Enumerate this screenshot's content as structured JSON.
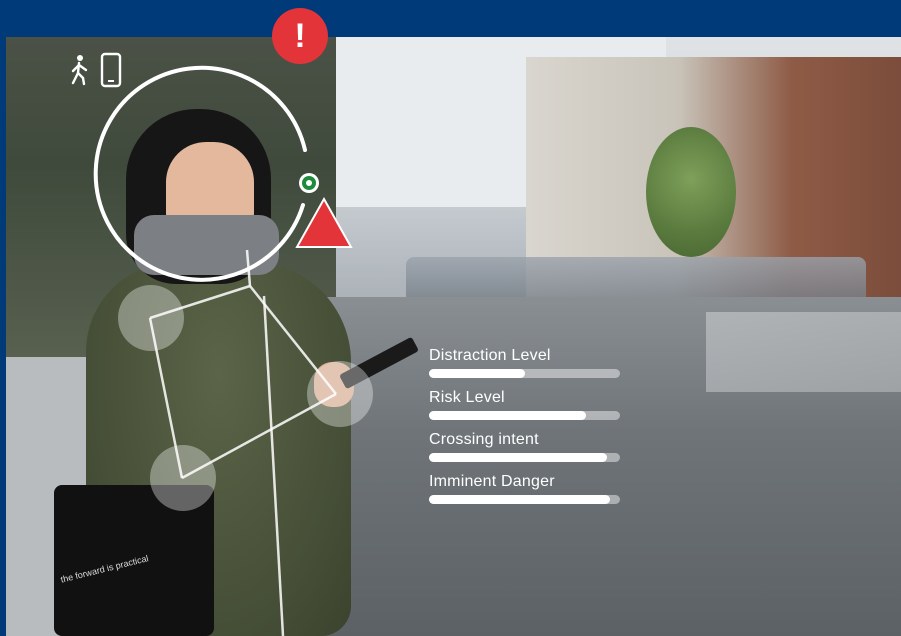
{
  "alert": {
    "symbol": "!"
  },
  "status_icons": {
    "pedestrian": "pedestrian-icon",
    "phone": "phone-icon"
  },
  "metrics": [
    {
      "label": "Distraction Level",
      "value": 0.5
    },
    {
      "label": "Risk Level",
      "value": 0.82
    },
    {
      "label": "Crossing intent",
      "value": 0.93
    },
    {
      "label": "Imminent Danger",
      "value": 0.95
    }
  ],
  "colors": {
    "frame": "#003a78",
    "alert_red": "#e3343a",
    "focus_green": "#1f8a3b",
    "overlay_white": "#ffffff"
  },
  "bag_text": "the forward is practical"
}
